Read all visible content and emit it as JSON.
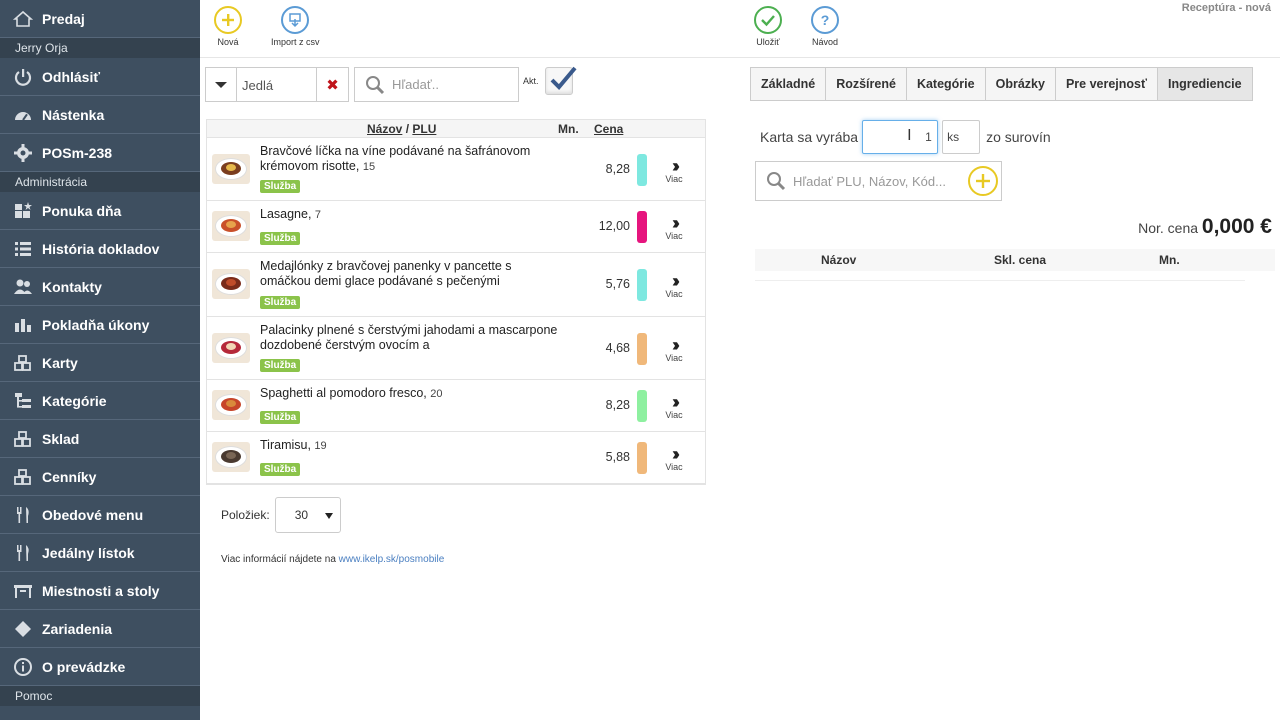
{
  "sidebar": {
    "items_top": [
      {
        "label": "Predaj",
        "icon": "home-icon"
      }
    ],
    "user_name": "Jerry Orja",
    "items_user": [
      {
        "label": "Odhlásiť",
        "icon": "power-icon"
      },
      {
        "label": "Nástenka",
        "icon": "dashboard-icon"
      },
      {
        "label": "POSm-238",
        "icon": "gear-icon"
      }
    ],
    "admin_section": "Administrácia",
    "items_admin": [
      {
        "label": "Ponuka dňa",
        "icon": "star-blocks-icon"
      },
      {
        "label": "História dokladov",
        "icon": "list-icon"
      },
      {
        "label": "Kontakty",
        "icon": "users-icon"
      },
      {
        "label": "Pokladňa úkony",
        "icon": "bars-icon"
      },
      {
        "label": "Karty",
        "icon": "blocks-icon"
      },
      {
        "label": "Kategórie",
        "icon": "tree-icon"
      },
      {
        "label": "Sklad",
        "icon": "blocks-icon"
      },
      {
        "label": "Cenníky",
        "icon": "blocks-icon"
      },
      {
        "label": "Obedové menu",
        "icon": "cutlery-icon"
      },
      {
        "label": "Jedálny lístok",
        "icon": "cutlery-icon"
      },
      {
        "label": "Miestnosti a stoly",
        "icon": "table-icon"
      },
      {
        "label": "Zariadenia",
        "icon": "diamond-icon"
      },
      {
        "label": "O prevádzke",
        "icon": "info-icon"
      }
    ],
    "help_section": "Pomoc"
  },
  "toolbar": {
    "new_label": "Nová",
    "import_label": "Import z csv",
    "save_label": "Uložiť",
    "help_label": "Návod",
    "status": "Receptúra - nová"
  },
  "filter": {
    "category": "Jedlá",
    "search_placeholder": "Hľadať..",
    "active_label": "Akt."
  },
  "product_table": {
    "col_name": "Názov",
    "col_sep": "/",
    "col_plu": "PLU",
    "col_qty": "Mn.",
    "col_price": "Cena",
    "more_label": "Viac",
    "rows": [
      {
        "name": "Bravčové líčka na víne podávané na šafránovom krémovom risotte,",
        "plu": "15",
        "badge": "Služba",
        "price": "8,28",
        "color": "#7ee8e0"
      },
      {
        "name": "Lasagne,",
        "plu": "7",
        "badge": "Služba",
        "price": "12,00",
        "color": "#e6157e"
      },
      {
        "name": "Medajlónky z bravčovej panenky v pancette s omáčkou demi glace podávané s pečenými",
        "plu": "",
        "badge": "Služba",
        "price": "5,76",
        "color": "#7ee8e0"
      },
      {
        "name": "Palacinky plnené s čerstvými jahodami a mascarpone dozdobené čerstvým ovocím a",
        "plu": "",
        "badge": "Služba",
        "price": "4,68",
        "color": "#f0b87a"
      },
      {
        "name": "Spaghetti al pomodoro fresco,",
        "plu": "20",
        "badge": "Služba",
        "price": "8,28",
        "color": "#8ef0a0"
      },
      {
        "name": "Tiramisu,",
        "plu": "19",
        "badge": "Služba",
        "price": "5,88",
        "color": "#f0b87a"
      }
    ]
  },
  "pagination": {
    "label": "Položiek:",
    "value": "30"
  },
  "footer": {
    "text": "Viac informácií nájdete na",
    "link": "www.ikelp.sk/posmobile"
  },
  "tabs": [
    {
      "label": "Základné",
      "active": false
    },
    {
      "label": "Rozšírené",
      "active": false
    },
    {
      "label": "Kategórie",
      "active": false
    },
    {
      "label": "Obrázky",
      "active": false
    },
    {
      "label": "Pre verejnosť",
      "active": false
    },
    {
      "label": "Ingrediencie",
      "active": true
    }
  ],
  "recipe": {
    "produced_label": "Karta sa vyrába",
    "qty_value": "1",
    "unit": "ks",
    "from_label": "zo surovín",
    "search_placeholder": "Hľadať PLU, Názov, Kód...",
    "nor_price_label": "Nor. cena",
    "nor_price_value": "0,000 €",
    "col_name": "Názov",
    "col_stock_price": "Skl. cena",
    "col_qty": "Mn."
  },
  "colors": {
    "sidebar_bg": "#3e4f60",
    "new_icon": "#e8c923",
    "import_icon": "#5b9bd5",
    "save_icon": "#4caf50",
    "help_icon": "#5b9bd5",
    "badge": "#8bc34a"
  }
}
